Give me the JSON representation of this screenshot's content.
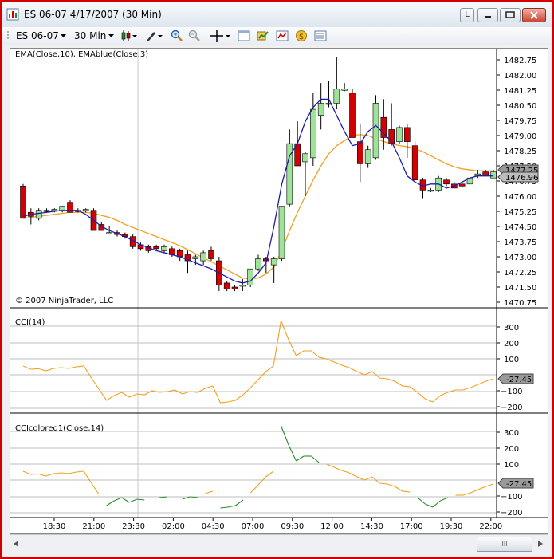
{
  "window": {
    "title": "ES 06-07  4/17/2007  (30 Min)",
    "buttons": {
      "link": "L"
    }
  },
  "toolbar": {
    "instrument": "ES 06-07",
    "interval": "30 Min"
  },
  "price_panel": {
    "label": "EMA(Close,10), EMAblue(Close,3)",
    "copyright": "© 2007 NinjaTrader, LLC",
    "y_ticks": [
      "1482.75",
      "1482.00",
      "1481.25",
      "1480.50",
      "1479.75",
      "1479.00",
      "1478.25",
      "1477.50",
      "1476.75",
      "1476.00",
      "1475.25",
      "1474.50",
      "1473.75",
      "1473.00",
      "1472.25",
      "1471.50",
      "1470.75"
    ],
    "markers": [
      "1477.25",
      "1476.96"
    ],
    "colors": {
      "up": "#9fe29a",
      "down": "#d40000",
      "ema10": "#f0a020",
      "emablue": "#1c1caa"
    }
  },
  "cci_panel": {
    "label": "CCI(14)",
    "y_ticks": [
      "300",
      "200",
      "100",
      "-100",
      "-200"
    ],
    "marker": "-27.45",
    "color": "#f0a020"
  },
  "cci_colored_panel": {
    "label": "CCIcolored1(Close,14)",
    "y_ticks": [
      "300",
      "200",
      "100",
      "-100",
      "-200"
    ],
    "marker": "-27.45",
    "colors": {
      "neutral": "#f0a020",
      "extreme": "#2a8a2a"
    }
  },
  "x_axis": {
    "labels": [
      "18:30",
      "21:00",
      "23:30",
      "02:00",
      "04:30",
      "07:00",
      "09:30",
      "12:00",
      "14:30",
      "17:00",
      "19:30",
      "22:00"
    ]
  },
  "scrollbar": {
    "thumb_label": "III"
  },
  "chart_data": {
    "type": "candlestick",
    "series": [
      {
        "name": "EMA(Close,10)",
        "values": [
          1474.9,
          1474.95,
          1475.0,
          1475.05,
          1475.1,
          1475.15,
          1475.2,
          1475.2,
          1475.2,
          1475.15,
          1475.05,
          1474.95,
          1474.8,
          1474.6,
          1474.45,
          1474.3,
          1474.15,
          1474.0,
          1473.85,
          1473.7,
          1473.55,
          1473.35,
          1473.15,
          1472.95,
          1472.75,
          1472.55,
          1472.35,
          1472.15,
          1471.95,
          1471.9,
          1471.95,
          1472.15,
          1472.5,
          1473.3,
          1474.3,
          1475.2,
          1476.0,
          1476.8,
          1477.5,
          1478.1,
          1478.5,
          1478.75,
          1479.0,
          1479.05,
          1479.0,
          1478.85,
          1478.7,
          1478.6,
          1478.5,
          1478.45,
          1478.35,
          1478.2,
          1478.0,
          1477.8,
          1477.6,
          1477.45,
          1477.35,
          1477.3,
          1477.25,
          1477.25,
          1477.25
        ]
      },
      {
        "name": "EMAblue(Close,3)",
        "values": [
          1475.0,
          1475.1,
          1475.15,
          1475.2,
          1475.25,
          1475.3,
          1475.3,
          1475.3,
          1475.1,
          1474.8,
          1474.5,
          1474.3,
          1474.15,
          1474.0,
          1473.8,
          1473.6,
          1473.45,
          1473.3,
          1473.2,
          1473.1,
          1473.0,
          1472.85,
          1472.7,
          1472.55,
          1472.4,
          1472.2,
          1472.0,
          1471.8,
          1471.7,
          1471.8,
          1472.2,
          1472.7,
          1474.5,
          1476.6,
          1478.0,
          1478.6,
          1479.7,
          1480.4,
          1480.8,
          1480.8,
          1480.0,
          1479.2,
          1478.5,
          1478.6,
          1479.2,
          1479.5,
          1479.1,
          1478.7,
          1477.9,
          1477.0,
          1476.7,
          1476.5,
          1476.6,
          1476.6,
          1476.4,
          1476.5,
          1476.7,
          1476.9,
          1477.0,
          1477.0,
          1477.0
        ]
      }
    ],
    "candles": [
      {
        "o": 1476.5,
        "h": 1476.6,
        "l": 1474.9,
        "c": 1474.9
      },
      {
        "o": 1475.2,
        "h": 1475.4,
        "l": 1474.6,
        "c": 1475.0
      },
      {
        "o": 1474.9,
        "h": 1475.4,
        "l": 1474.8,
        "c": 1475.3
      },
      {
        "o": 1475.3,
        "h": 1475.4,
        "l": 1475.2,
        "c": 1475.3
      },
      {
        "o": 1475.3,
        "h": 1475.4,
        "l": 1475.2,
        "c": 1475.35
      },
      {
        "o": 1475.3,
        "h": 1475.5,
        "l": 1475.2,
        "c": 1475.5
      },
      {
        "o": 1475.7,
        "h": 1475.8,
        "l": 1475.2,
        "c": 1475.2
      },
      {
        "o": 1475.3,
        "h": 1475.4,
        "l": 1475.2,
        "c": 1475.3
      },
      {
        "o": 1475.3,
        "h": 1475.4,
        "l": 1475.2,
        "c": 1475.35
      },
      {
        "o": 1475.3,
        "h": 1475.4,
        "l": 1474.3,
        "c": 1474.3
      },
      {
        "o": 1474.6,
        "h": 1474.7,
        "l": 1474.3,
        "c": 1474.3
      },
      {
        "o": 1474.2,
        "h": 1474.5,
        "l": 1474.1,
        "c": 1474.2
      },
      {
        "o": 1474.2,
        "h": 1474.3,
        "l": 1474.0,
        "c": 1474.1
      },
      {
        "o": 1474.1,
        "h": 1474.2,
        "l": 1473.9,
        "c": 1474.0
      },
      {
        "o": 1474.0,
        "h": 1474.1,
        "l": 1473.4,
        "c": 1473.5
      },
      {
        "o": 1473.6,
        "h": 1473.7,
        "l": 1473.3,
        "c": 1473.4
      },
      {
        "o": 1473.5,
        "h": 1473.6,
        "l": 1473.2,
        "c": 1473.3
      },
      {
        "o": 1473.5,
        "h": 1473.6,
        "l": 1473.3,
        "c": 1473.4
      },
      {
        "o": 1473.3,
        "h": 1473.6,
        "l": 1473.2,
        "c": 1473.5
      },
      {
        "o": 1473.4,
        "h": 1473.5,
        "l": 1473.0,
        "c": 1473.1
      },
      {
        "o": 1473.3,
        "h": 1473.4,
        "l": 1472.8,
        "c": 1473.0
      },
      {
        "o": 1473.1,
        "h": 1473.3,
        "l": 1472.2,
        "c": 1472.8
      },
      {
        "o": 1472.9,
        "h": 1473.1,
        "l": 1472.6,
        "c": 1473.0
      },
      {
        "o": 1472.8,
        "h": 1473.3,
        "l": 1472.6,
        "c": 1473.2
      },
      {
        "o": 1473.3,
        "h": 1473.5,
        "l": 1472.8,
        "c": 1472.9
      },
      {
        "o": 1472.8,
        "h": 1473.0,
        "l": 1471.3,
        "c": 1471.6
      },
      {
        "o": 1471.7,
        "h": 1471.8,
        "l": 1471.3,
        "c": 1471.4
      },
      {
        "o": 1471.5,
        "h": 1471.6,
        "l": 1471.3,
        "c": 1471.4
      },
      {
        "o": 1471.6,
        "h": 1471.9,
        "l": 1471.3,
        "c": 1471.6
      },
      {
        "o": 1471.6,
        "h": 1472.4,
        "l": 1471.5,
        "c": 1472.4
      },
      {
        "o": 1472.4,
        "h": 1473.1,
        "l": 1472.3,
        "c": 1472.9
      },
      {
        "o": 1472.9,
        "h": 1473.0,
        "l": 1472.2,
        "c": 1472.8
      },
      {
        "o": 1472.6,
        "h": 1473.0,
        "l": 1471.7,
        "c": 1472.9
      },
      {
        "o": 1472.9,
        "h": 1475.5,
        "l": 1472.8,
        "c": 1475.5
      },
      {
        "o": 1475.6,
        "h": 1479.3,
        "l": 1475.5,
        "c": 1478.6
      },
      {
        "o": 1478.6,
        "h": 1479.7,
        "l": 1477.5,
        "c": 1477.5
      },
      {
        "o": 1477.7,
        "h": 1478.2,
        "l": 1476.0,
        "c": 1478.1
      },
      {
        "o": 1477.9,
        "h": 1481.1,
        "l": 1477.5,
        "c": 1480.3
      },
      {
        "o": 1480.0,
        "h": 1481.6,
        "l": 1479.3,
        "c": 1480.6
      },
      {
        "o": 1480.6,
        "h": 1481.7,
        "l": 1480.4,
        "c": 1480.6
      },
      {
        "o": 1480.6,
        "h": 1482.9,
        "l": 1480.3,
        "c": 1481.3
      },
      {
        "o": 1481.3,
        "h": 1481.6,
        "l": 1481.2,
        "c": 1481.3
      },
      {
        "o": 1481.1,
        "h": 1481.3,
        "l": 1478.9,
        "c": 1478.9
      },
      {
        "o": 1478.7,
        "h": 1479.6,
        "l": 1476.7,
        "c": 1477.6
      },
      {
        "o": 1477.6,
        "h": 1478.5,
        "l": 1477.4,
        "c": 1478.3
      },
      {
        "o": 1477.9,
        "h": 1481.0,
        "l": 1477.8,
        "c": 1480.6
      },
      {
        "o": 1479.9,
        "h": 1480.8,
        "l": 1478.3,
        "c": 1478.9
      },
      {
        "o": 1479.3,
        "h": 1480.6,
        "l": 1478.5,
        "c": 1478.6
      },
      {
        "o": 1478.7,
        "h": 1479.5,
        "l": 1478.6,
        "c": 1479.4
      },
      {
        "o": 1479.4,
        "h": 1479.6,
        "l": 1477.9,
        "c": 1478.7
      },
      {
        "o": 1478.5,
        "h": 1478.7,
        "l": 1476.8,
        "c": 1476.8
      },
      {
        "o": 1476.8,
        "h": 1476.9,
        "l": 1475.9,
        "c": 1476.3
      },
      {
        "o": 1476.3,
        "h": 1476.4,
        "l": 1476.2,
        "c": 1476.3
      },
      {
        "o": 1476.3,
        "h": 1477.0,
        "l": 1476.2,
        "c": 1476.9
      },
      {
        "o": 1476.8,
        "h": 1476.9,
        "l": 1476.5,
        "c": 1476.6
      },
      {
        "o": 1476.6,
        "h": 1476.7,
        "l": 1476.4,
        "c": 1476.4
      },
      {
        "o": 1476.6,
        "h": 1476.7,
        "l": 1476.4,
        "c": 1476.5
      },
      {
        "o": 1476.6,
        "h": 1477.1,
        "l": 1476.6,
        "c": 1476.9
      },
      {
        "o": 1477.0,
        "h": 1477.3,
        "l": 1476.9,
        "c": 1477.1
      },
      {
        "o": 1477.2,
        "h": 1477.3,
        "l": 1477.0,
        "c": 1477.0
      },
      {
        "o": 1476.9,
        "h": 1477.3,
        "l": 1476.9,
        "c": 1477.2
      }
    ],
    "cci": [
      55,
      35,
      38,
      25,
      40,
      45,
      40,
      50,
      55,
      -20,
      -90,
      -160,
      -130,
      -110,
      -140,
      -120,
      -125,
      -100,
      -110,
      -105,
      -95,
      -120,
      -105,
      -110,
      -85,
      -70,
      -175,
      -170,
      -160,
      -125,
      -80,
      -30,
      20,
      55,
      340,
      220,
      120,
      150,
      150,
      110,
      100,
      80,
      60,
      45,
      20,
      0,
      20,
      -20,
      -25,
      -40,
      -70,
      -75,
      -110,
      -150,
      -170,
      -130,
      -110,
      -95,
      -95,
      -80,
      -60,
      -40,
      -25
    ]
  }
}
